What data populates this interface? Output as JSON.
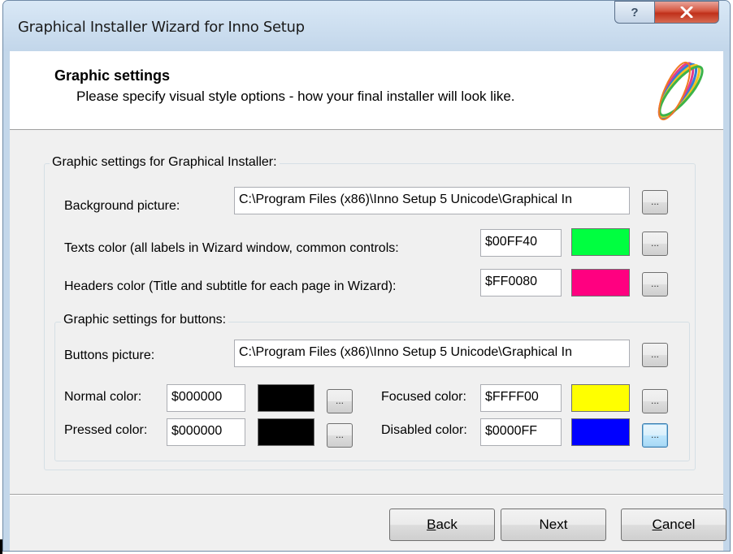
{
  "window": {
    "title": "Graphical Installer Wizard for Inno Setup",
    "help_glyph": "?",
    "close_glyph": "x"
  },
  "header": {
    "title": "Graphic settings",
    "subtitle": "Please specify visual style options - how your final installer will look like.",
    "logo_icon": "colorful-rings-logo"
  },
  "installer_group": {
    "title": "Graphic settings for Graphical Installer:",
    "background_label": "Background picture:",
    "background_value": "C:\\Program Files (x86)\\Inno Setup 5 Unicode\\Graphical In",
    "texts_color_label": "Texts color (all labels in Wizard window, common controls:",
    "texts_color_value": "$00FF40",
    "texts_color_hex": "#00FF40",
    "headers_color_label": "Headers color (Title and subtitle for each page in Wizard):",
    "headers_color_value": "$FF0080",
    "headers_color_hex": "#FF0080"
  },
  "buttons_group": {
    "title": "Graphic settings for buttons:",
    "picture_label": "Buttons picture:",
    "picture_value": "C:\\Program Files (x86)\\Inno Setup 5 Unicode\\Graphical In",
    "normal_label": "Normal color:",
    "normal_value": "$000000",
    "normal_hex": "#000000",
    "pressed_label": "Pressed color:",
    "pressed_value": "$000000",
    "pressed_hex": "#000000",
    "focused_label": "Focused color:",
    "focused_value": "$FFFF00",
    "focused_hex": "#FFFF00",
    "disabled_label": "Disabled color:",
    "disabled_value": "$0000FF",
    "disabled_hex": "#0000FF"
  },
  "browse_label": "...",
  "nav": {
    "back_accel": "B",
    "back_rest": "ack",
    "next": "Next",
    "cancel_accel": "C",
    "cancel_rest": "ancel"
  }
}
